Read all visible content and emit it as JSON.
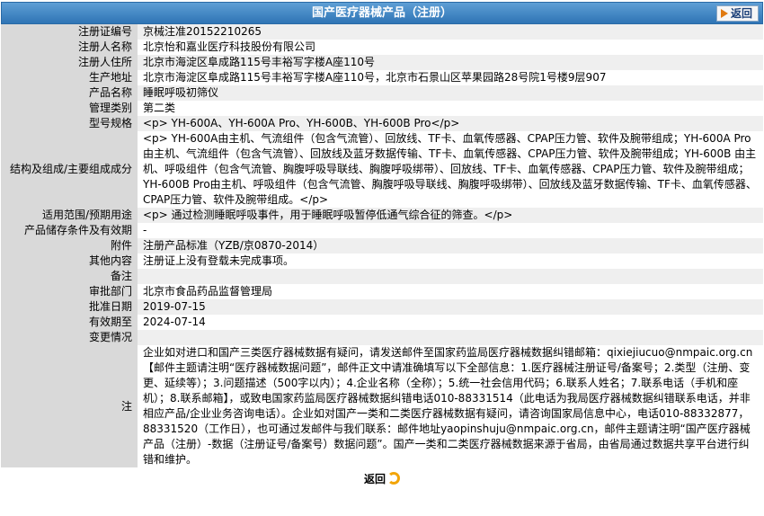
{
  "header": {
    "title": "国产医疗器械产品（注册）",
    "back_label": "返回"
  },
  "fields": [
    {
      "label": "注册证编号",
      "value": "京械注准20152210265"
    },
    {
      "label": "注册人名称",
      "value": "北京怡和嘉业医疗科技股份有限公司"
    },
    {
      "label": "注册人住所",
      "value": "北京市海淀区阜成路115号丰裕写字楼A座110号"
    },
    {
      "label": "生产地址",
      "value": "北京市海淀区阜成路115号丰裕写字楼A座110号，北京市石景山区苹果园路28号院1号楼9层907"
    },
    {
      "label": "产品名称",
      "value": "睡眠呼吸初筛仪"
    },
    {
      "label": "管理类别",
      "value": "第二类"
    },
    {
      "label": "型号规格",
      "value": "<p> YH-600A、YH-600A Pro、YH-600B、YH-600B Pro</p>"
    },
    {
      "label": "结构及组成/主要组成成分",
      "value": "<p> YH-600A由主机、气流组件（包含气流管）、回放线、TF卡、血氧传感器、CPAP压力管、软件及腕带组成；YH-600A Pro由主机、气流组件（包含气流管）、回放线及蓝牙数据传输、TF卡、血氧传感器、CPAP压力管、软件及腕带组成；YH-600B 由主机、呼吸组件（包含气流管、胸腹呼吸导联线、胸腹呼吸绑带）、回放线、TF卡、血氧传感器、CPAP压力管、软件及腕带组成；YH-600B Pro由主机、呼吸组件（包含气流管、胸腹呼吸导联线、胸腹呼吸绑带）、回放线及蓝牙数据传输、TF卡、血氧传感器、CPAP压力管、软件及腕带组成。</p>"
    },
    {
      "label": "适用范围/预期用途",
      "value": "<p> 通过检测睡眠呼吸事件，用于睡眠呼吸暂停低通气综合征的筛查。</p>"
    },
    {
      "label": "产品储存条件及有效期",
      "value": "-"
    },
    {
      "label": "附件",
      "value": "注册产品标准（YZB/京0870-2014）"
    },
    {
      "label": "其他内容",
      "value": "注册证上没有登载未完成事项。"
    },
    {
      "label": "备注",
      "value": ""
    },
    {
      "label": "审批部门",
      "value": "北京市食品药品监督管理局"
    },
    {
      "label": "批准日期",
      "value": "2019-07-15"
    },
    {
      "label": "有效期至",
      "value": "2024-07-14"
    },
    {
      "label": "变更情况",
      "value": ""
    },
    {
      "label": "注",
      "value": "企业如对进口和国产三类医疗器械数据有疑问，请发送邮件至国家药监局医疗器械数据纠错邮箱：qixiejiucuo@nmpaic.org.cn【邮件主题请注明“医疗器械数据问题”，邮件正文中请准确填写以下全部信息：1.医疗器械注册证号/备案号；2.类型（注册、变更、延续等）；3.问题描述（500字以内）；4.企业名称（全称）；5.统一社会信用代码；6.联系人姓名；7.联系电话（手机和座机）；8.联系邮箱】，或致电国家药监局医疗器械数据纠错电话010-88331514（此电话为我局医疗器械数据纠错联系电话，并非相应产品/企业业务咨询电话）。企业如对国产一类和二类医疗器械数据有疑问，请咨询国家局信息中心，电话010-88332877，88331520（工作日），也可通过发邮件与我们联系：邮件地址yaopinshuju@nmpaic.org.cn，邮件主题请注明“国产医疗器械产品（注册）-数据（注册证号/备案号）数据问题”。国产一类和二类医疗器械数据来源于省局，由省局通过数据共享平台进行纠错和维护。"
    }
  ],
  "footer": {
    "back_label": "返回"
  }
}
